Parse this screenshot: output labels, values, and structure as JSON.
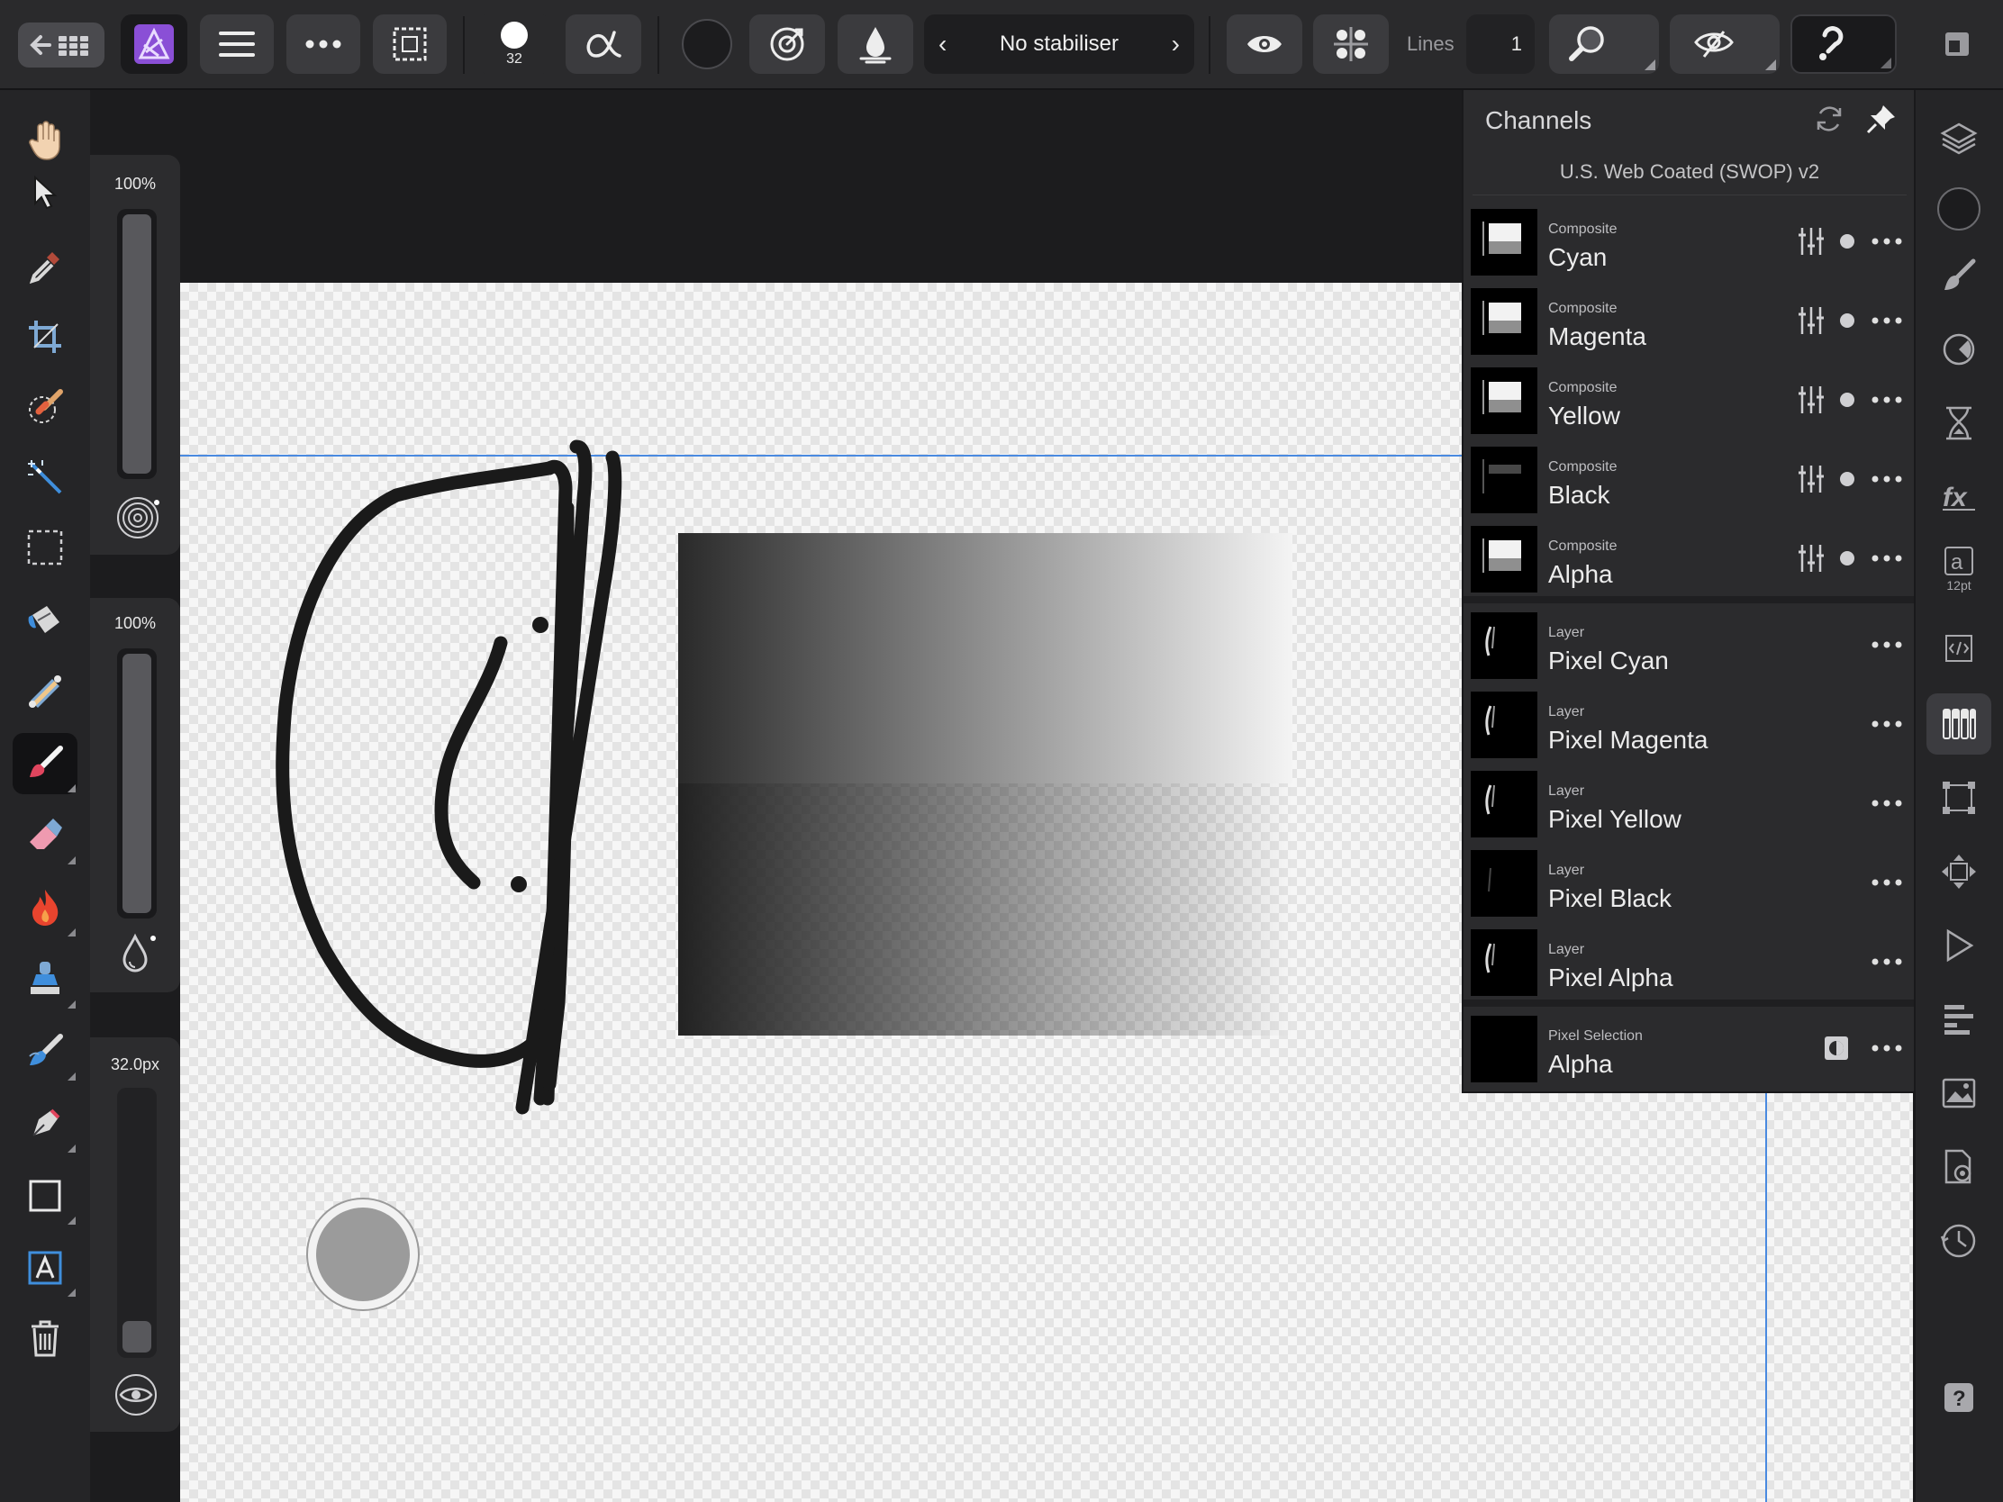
{
  "toolbar": {
    "brush_size": "32",
    "stabiliser_label": "No stabiliser",
    "lines_label": "Lines",
    "lines_value": "1"
  },
  "sliders": {
    "opacity_value": "100%",
    "flow_value": "100%",
    "width_value": "32.0px",
    "opacity_level": 1.0,
    "flow_level": 1.0,
    "width_level": 0.12
  },
  "channels": {
    "title": "Channels",
    "profile": "U.S. Web Coated (SWOP) v2",
    "composite": [
      {
        "kind": "Composite",
        "name": "Cyan"
      },
      {
        "kind": "Composite",
        "name": "Magenta"
      },
      {
        "kind": "Composite",
        "name": "Yellow"
      },
      {
        "kind": "Composite",
        "name": "Black"
      },
      {
        "kind": "Composite",
        "name": "Alpha"
      }
    ],
    "layer": [
      {
        "kind": "Layer",
        "name": "Pixel Cyan"
      },
      {
        "kind": "Layer",
        "name": "Pixel Magenta"
      },
      {
        "kind": "Layer",
        "name": "Pixel Yellow"
      },
      {
        "kind": "Layer",
        "name": "Pixel Black"
      },
      {
        "kind": "Layer",
        "name": "Pixel Alpha"
      }
    ],
    "selection": {
      "kind": "Pixel Selection",
      "name": "Alpha"
    }
  },
  "studio": {
    "text_size": "12pt"
  },
  "colors": {
    "accent_purple": "#8a4fd6",
    "brush_red": "#e0455e",
    "flame_red": "#e8442e",
    "tool_blue": "#3f8edc",
    "guide_blue": "#4a8ae0"
  }
}
